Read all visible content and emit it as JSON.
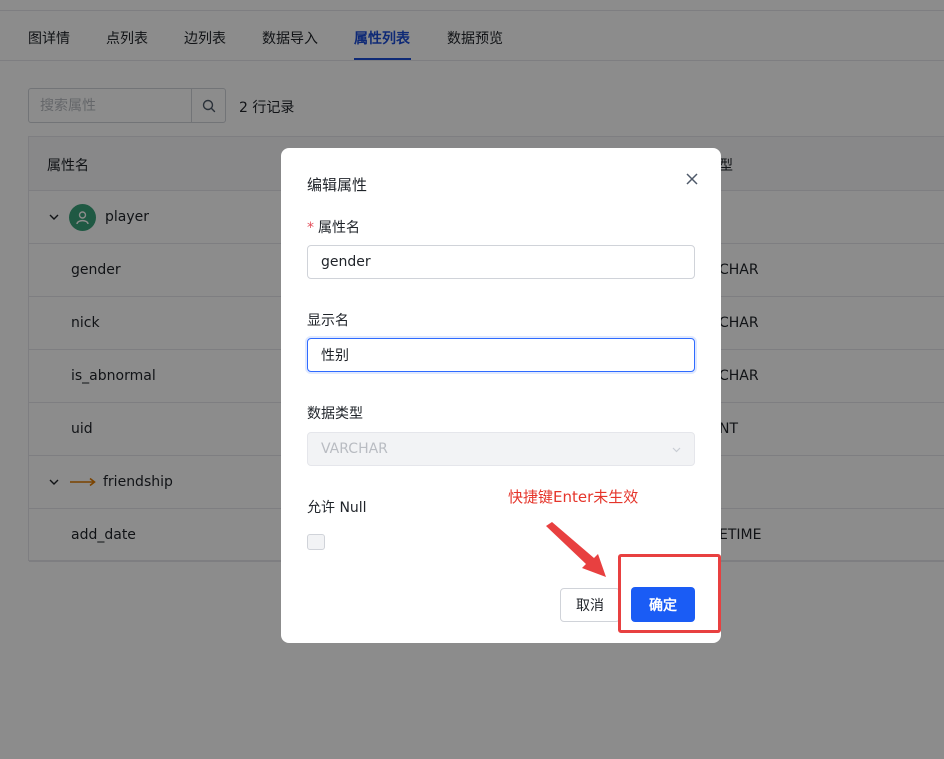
{
  "tabs": [
    {
      "label": "图详情",
      "active": false
    },
    {
      "label": "点列表",
      "active": false
    },
    {
      "label": "边列表",
      "active": false
    },
    {
      "label": "数据导入",
      "active": false
    },
    {
      "label": "属性列表",
      "active": true
    },
    {
      "label": "数据预览",
      "active": false
    }
  ],
  "search": {
    "placeholder": "搜索属性",
    "icon": "search-icon"
  },
  "record_count": "2 行记录",
  "table": {
    "headers": [
      "属性名",
      "型"
    ],
    "rows": [
      {
        "name": "player",
        "type": "",
        "kind": "vertex-group"
      },
      {
        "name": "gender",
        "type": "CHAR",
        "kind": "prop"
      },
      {
        "name": "nick",
        "type": "CHAR",
        "kind": "prop"
      },
      {
        "name": "is_abnormal",
        "type": "CHAR",
        "kind": "prop"
      },
      {
        "name": "uid",
        "type": "NT",
        "kind": "prop"
      },
      {
        "name": "friendship",
        "type": "",
        "kind": "edge-group"
      },
      {
        "name": "add_date",
        "type": "ETIME",
        "kind": "prop"
      }
    ]
  },
  "modal": {
    "title": "编辑属性",
    "required_mark": "*",
    "name_label": "属性名",
    "name_value": "gender",
    "display_label": "显示名",
    "display_value": "性别",
    "type_label": "数据类型",
    "type_value": "VARCHAR",
    "nullable_label": "允许 Null",
    "cancel_label": "取消",
    "ok_label": "确定"
  },
  "annotation": {
    "text": "快捷键Enter未生效",
    "color": "#e5352b"
  },
  "colors": {
    "accent": "#1d4ed8",
    "primary_button": "#1a5cf5",
    "annotation": "#e84040"
  }
}
